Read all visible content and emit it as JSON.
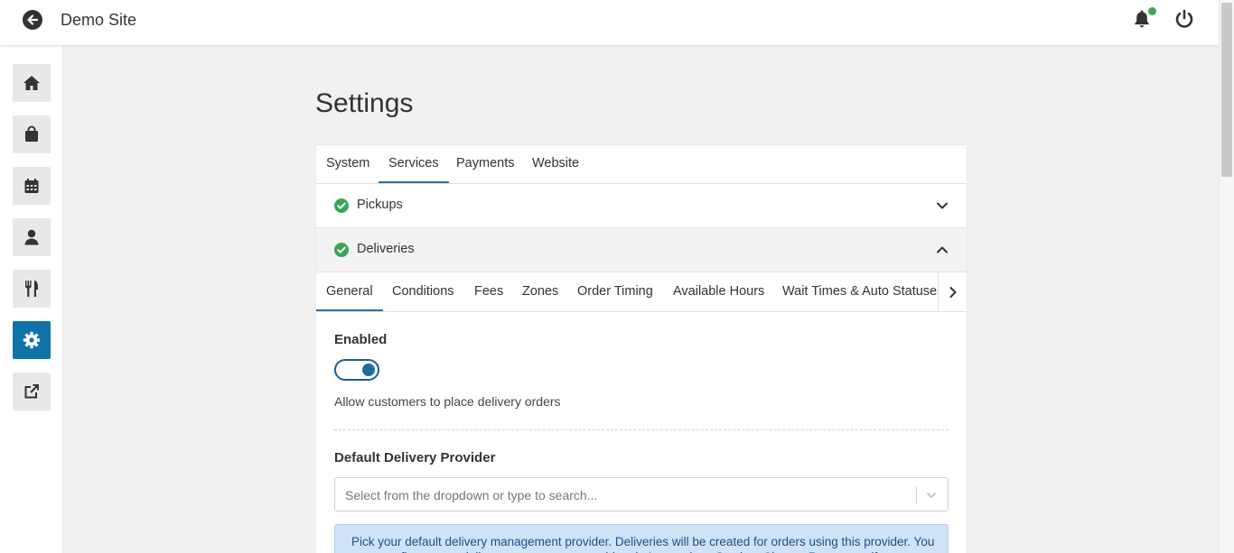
{
  "header": {
    "site_title": "Demo Site",
    "icons": [
      "back-arrow-icon",
      "bell-icon",
      "power-icon"
    ],
    "notification_dot_color": "#3aa655"
  },
  "sidebar": {
    "items": [
      {
        "icon": "home-icon"
      },
      {
        "icon": "shopping-bag-icon"
      },
      {
        "icon": "calendar-icon"
      },
      {
        "icon": "user-icon"
      },
      {
        "icon": "utensils-icon"
      },
      {
        "icon": "gear-icon",
        "active": true
      },
      {
        "icon": "external-link-icon"
      }
    ],
    "active_color": "#0f73a8"
  },
  "page": {
    "title": "Settings"
  },
  "tabs": [
    {
      "label": "System"
    },
    {
      "label": "Services",
      "active": true
    },
    {
      "label": "Payments"
    },
    {
      "label": "Website"
    }
  ],
  "accordion": [
    {
      "label": "Pickups",
      "status": "check-circle-icon",
      "expanded": false
    },
    {
      "label": "Deliveries",
      "status": "check-circle-icon",
      "expanded": true
    }
  ],
  "delivery_tabs": [
    {
      "label": "General",
      "active": true
    },
    {
      "label": "Conditions"
    },
    {
      "label": "Fees"
    },
    {
      "label": "Zones"
    },
    {
      "label": "Order Timing"
    },
    {
      "label": "Available Hours"
    },
    {
      "label": "Wait Times & Auto Statuses"
    }
  ],
  "general": {
    "enabled_label": "Enabled",
    "enabled_value": true,
    "enabled_help": "Allow customers to place delivery orders",
    "provider_label": "Default Delivery Provider",
    "provider_placeholder": "Select from the dropdown or type to search...",
    "info_text": "Pick your default delivery management provider. Deliveries will be created for orders using this provider. You must configure your delivery management providers in Integrations Section. Choose Restaurant if"
  },
  "colors": {
    "accent": "#2a6fa6",
    "success": "#3aa655",
    "info_bg": "#cfe2f6",
    "info_text": "#1f4f85"
  }
}
